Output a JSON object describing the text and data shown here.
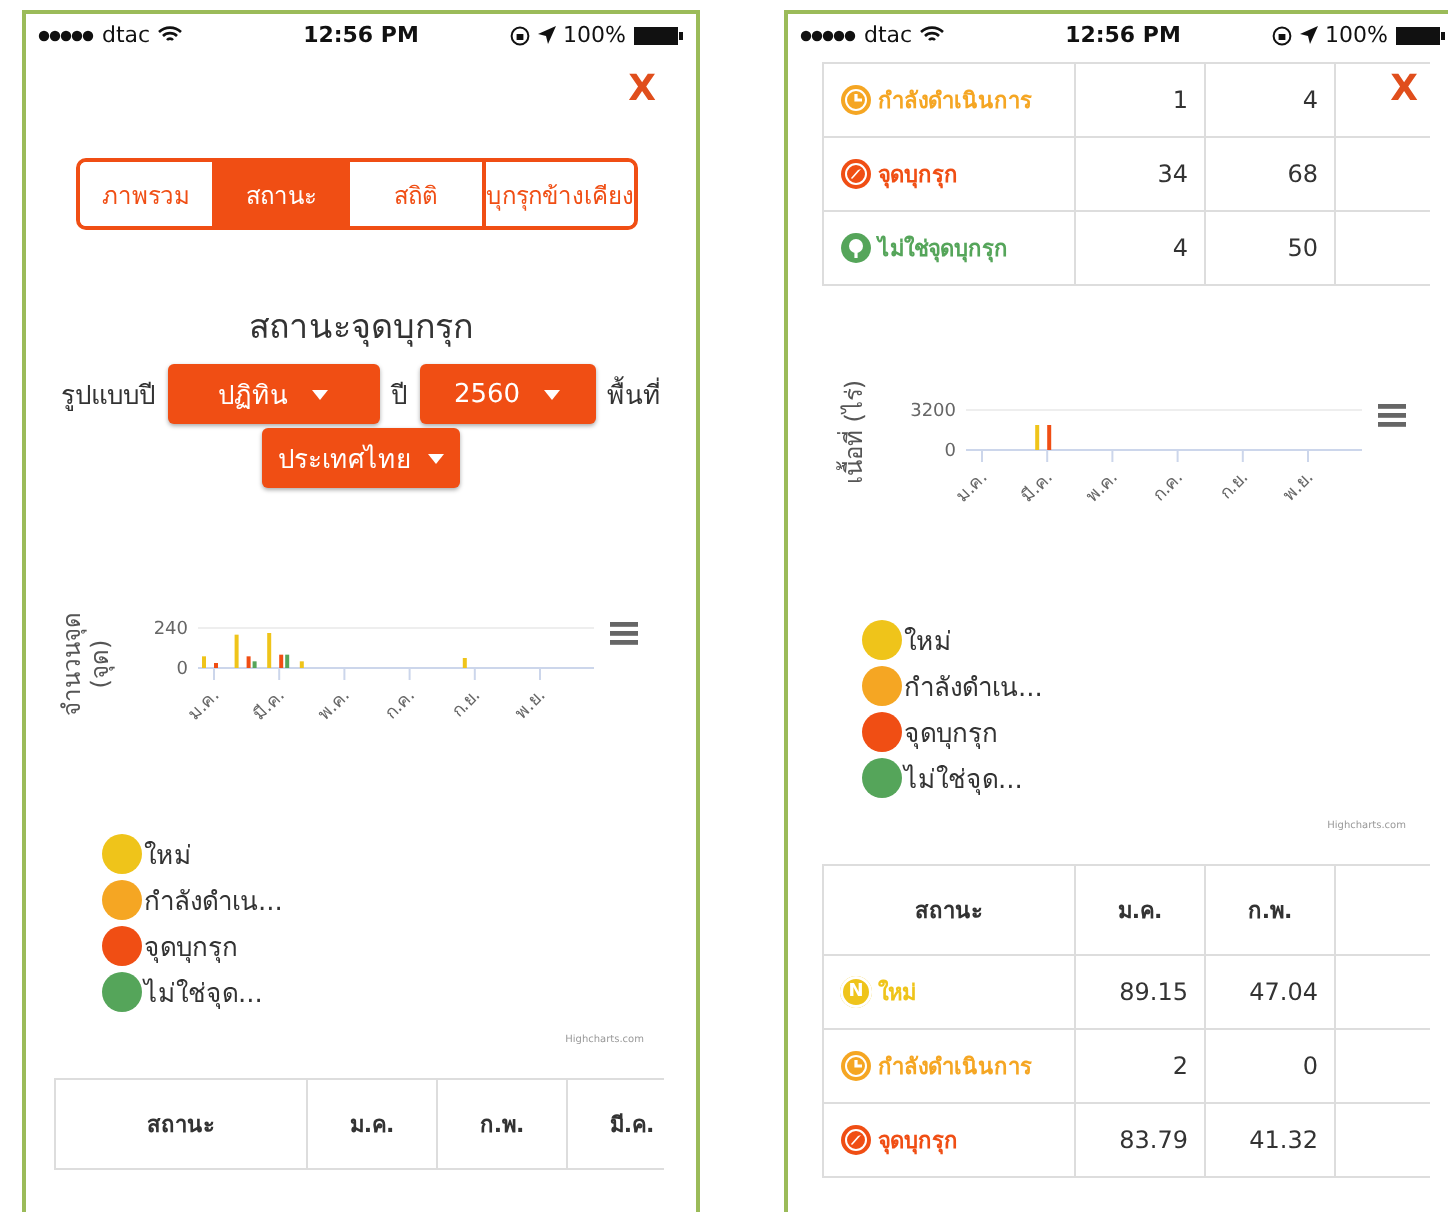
{
  "phones": [
    {
      "status_bar": {
        "carrier": "dtac",
        "time": "12:56 PM",
        "battery": "100%"
      },
      "close": "X",
      "sections": [
        {
          "kind": "tabs",
          "items": [
            {
              "label": "ภาพรวม",
              "selected": false
            },
            {
              "label": "สถานะ",
              "selected": true
            },
            {
              "label": "สถิติ",
              "selected": false
            },
            {
              "label": "บุกรุกข้างเคียง",
              "selected": false
            }
          ]
        },
        {
          "kind": "filters",
          "title": "สถานะจุดบุกรุก",
          "year_type_label": "รูปแบบปี",
          "year_type": "ปฏิทิน",
          "year_label": "ปี",
          "year": "2560",
          "area_label": "พื้นที่",
          "area": "ประเทศไทย"
        },
        {
          "kind": "chart",
          "credit": "Highcharts.com",
          "chart_data": {
            "type": "bar",
            "ylabel": "จำนวนจุด (จุด)",
            "categories": [
              "ม.ค.",
              null,
              "มี.ค.",
              null,
              "พ.ค.",
              null,
              "ก.ค.",
              null,
              "ก.ย.",
              null,
              "พ.ย.",
              null
            ],
            "yticks": [
              0,
              240
            ],
            "ylim": [
              0,
              240
            ],
            "series": [
              {
                "name": "ใหม่",
                "color": "#efc41a",
                "values": [
                  70,
                  200,
                  210,
                  40,
                  0,
                  0,
                  0,
                  0,
                  60,
                  0,
                  0,
                  0
                ]
              },
              {
                "name": "กำลังดำเน...",
                "color": "#f5a623",
                "values": [
                  0,
                  0,
                  0,
                  0,
                  0,
                  0,
                  0,
                  0,
                  0,
                  0,
                  0,
                  0
                ]
              },
              {
                "name": "จุดบุกรุก",
                "color": "#f04e14",
                "values": [
                  30,
                  70,
                  80,
                  0,
                  0,
                  0,
                  0,
                  0,
                  0,
                  0,
                  0,
                  0
                ]
              },
              {
                "name": "ไม่ใช่จุด...",
                "color": "#55a55a",
                "values": [
                  0,
                  40,
                  80,
                  0,
                  0,
                  0,
                  0,
                  0,
                  0,
                  0,
                  0,
                  0
                ]
              }
            ]
          }
        },
        {
          "kind": "table",
          "status_header": "สถานะ",
          "columns": [
            "ม.ค.",
            "ก.พ.",
            "มี.ค."
          ]
        }
      ]
    },
    {
      "status_bar": {
        "carrier": "dtac",
        "time": "12:56 PM",
        "battery": "100%"
      },
      "close": "X",
      "sections": [
        {
          "kind": "table",
          "rows": [
            {
              "kind": "in_progress",
              "color": "#f5a623",
              "label": "กำลังดำเนินการ",
              "cells": [
                "1",
                "4"
              ]
            },
            {
              "kind": "encroach",
              "color": "#f04e14",
              "label": "จุดบุกรุก",
              "cells": [
                "34",
                "68"
              ]
            },
            {
              "kind": "not_encroach",
              "color": "#55a55a",
              "label": "ไม่ใช่จุดบุกรุก",
              "cells": [
                "4",
                "50"
              ]
            }
          ]
        },
        {
          "kind": "chart",
          "credit": "Highcharts.com",
          "chart_data": {
            "type": "bar",
            "ylabel": "เนื้อที่ (ไร่)",
            "categories": [
              "ม.ค.",
              null,
              "มี.ค.",
              null,
              "พ.ค.",
              null,
              "ก.ค.",
              null,
              "ก.ย.",
              null,
              "พ.ย.",
              null
            ],
            "yticks": [
              0,
              3200
            ],
            "ylim": [
              0,
              3200
            ],
            "series": [
              {
                "name": "ใหม่",
                "color": "#efc41a",
                "values": [
                  0,
                  0,
                  2000,
                  0,
                  0,
                  0,
                  0,
                  0,
                  0,
                  0,
                  0,
                  0
                ]
              },
              {
                "name": "กำลังดำเน...",
                "color": "#f5a623",
                "values": [
                  0,
                  0,
                  0,
                  0,
                  0,
                  0,
                  0,
                  0,
                  0,
                  0,
                  0,
                  0
                ]
              },
              {
                "name": "จุดบุกรุก",
                "color": "#f04e14",
                "values": [
                  0,
                  0,
                  2000,
                  0,
                  0,
                  0,
                  0,
                  0,
                  0,
                  0,
                  0,
                  0
                ]
              },
              {
                "name": "ไม่ใช่จุด...",
                "color": "#55a55a",
                "values": [
                  0,
                  0,
                  0,
                  0,
                  0,
                  0,
                  0,
                  0,
                  0,
                  0,
                  0,
                  0
                ]
              }
            ]
          }
        },
        {
          "kind": "table",
          "status_header": "สถานะ",
          "columns": [
            "ม.ค.",
            "ก.พ."
          ],
          "rows": [
            {
              "kind": "new",
              "badge": "N",
              "color": "#efc41a",
              "label": "ใหม่",
              "cells": [
                "89.15",
                "47.04"
              ]
            },
            {
              "kind": "in_progress",
              "color": "#f5a623",
              "label": "กำลังดำเนินการ",
              "cells": [
                "2",
                "0"
              ]
            },
            {
              "kind": "encroach",
              "color": "#f04e14",
              "label": "จุดบุกรุก",
              "cells": [
                "83.79",
                "41.32"
              ]
            }
          ]
        }
      ]
    }
  ]
}
